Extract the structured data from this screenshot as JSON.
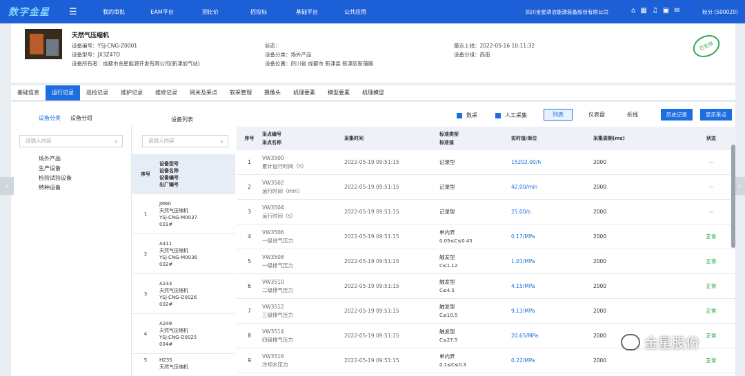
{
  "topbar": {
    "logo": "数字金星",
    "nav": [
      "我的审批",
      "EAM平台",
      "测比价",
      "招投标",
      "基础平台",
      "公共应用"
    ],
    "company": "四川金星清洁能源装备股份有限公司",
    "user": "秋分 (S00020)"
  },
  "header": {
    "title": "天然气压缩机",
    "code": "设备编号：YSJ-CNG-Z0001",
    "model": "设备型号：JX3Z47D",
    "owner": "设备所有者：成都市金星能源开发有限公司(新津加气站)",
    "status": "状态：",
    "category": "设备分类：场外产品",
    "location": "设备位置：四川省 成都市 新津县 新津区新蒲路",
    "last_online": "最近上线：2022-05-16 10:11:32",
    "group": "设备分组：西南",
    "stamp": "已生效"
  },
  "tabs": [
    "基础信息",
    "运行记录",
    "巡检记录",
    "维护记录",
    "维修记录",
    "网关及采点",
    "软采管理",
    "摄像头",
    "机理要素",
    "模型要素",
    "机理模型"
  ],
  "panel": {
    "cat_tabs": [
      "设备分类",
      "设备分组"
    ],
    "list_title": "设备列表",
    "search_placeholder": "请输入内容",
    "categories": [
      "场外产品",
      "生产设备",
      "检验试验设备",
      "特种设备"
    ],
    "legend": [
      "数采",
      "人工采集"
    ],
    "view_buttons": [
      "列表",
      "仪表盘",
      "折线"
    ],
    "history_button": "历史记录",
    "show_button": "显示采点"
  },
  "eq_table": {
    "head_no": "序号",
    "head_cols": "设备型号\n设备名称\n设备编号\n出厂编号",
    "rows": [
      {
        "no": "1",
        "info": "JM60\n天然气压缩机\nYSJ-CNG-M0037\n001#"
      },
      {
        "no": "2",
        "info": "A411\n天然气压缩机\nYSJ-CNG-M0036\n002#"
      },
      {
        "no": "3",
        "info": "A233\n天然气压缩机\nYSJ-CNG-D0026\n002#"
      },
      {
        "no": "4",
        "info": "A249\n天然气压缩机\nYSJ-CNG-D0025\n004#"
      },
      {
        "no": "5",
        "info": "H235\n天然气压缩机"
      }
    ]
  },
  "data_table": {
    "headers": {
      "no": "序号",
      "point": "采点编号\n采点名称",
      "time": "采集时间",
      "type": "标准类型\n标准值",
      "value": "实时值/单位",
      "cycle": "采集周期(ms)",
      "status": "状态"
    },
    "rows": [
      {
        "no": "1",
        "code": "VW3500",
        "name": "累计运行时间（h）",
        "time": "2022-05-19 09:51:15",
        "type": "记录型",
        "std": "",
        "value": "15202.00/h",
        "cycle": "2000",
        "status": "--"
      },
      {
        "no": "2",
        "code": "VW3502",
        "name": "运行时间（min）",
        "time": "2022-05-19 09:51:15",
        "type": "记录型",
        "std": "",
        "value": "42.00/min",
        "cycle": "2000",
        "status": "--"
      },
      {
        "no": "3",
        "code": "VW3504",
        "name": "运行时间（s）",
        "time": "2022-05-19 09:51:15",
        "type": "记录型",
        "std": "",
        "value": "25.00/s",
        "cycle": "2000",
        "status": "--"
      },
      {
        "no": "4",
        "code": "VW3506",
        "name": "一级进气压力",
        "time": "2022-05-19 09:51:15",
        "type": "单内界",
        "std": "0.05≤C≤0.45",
        "value": "0.17/MPa",
        "cycle": "2000",
        "status": "正常"
      },
      {
        "no": "5",
        "code": "VW3508",
        "name": "一级排气压力",
        "time": "2022-05-19 09:51:15",
        "type": "触发型",
        "std": "C≤1.12",
        "value": "1.01/MPa",
        "cycle": "2000",
        "status": "正常"
      },
      {
        "no": "6",
        "code": "VW3510",
        "name": "二级排气压力",
        "time": "2022-05-19 09:51:15",
        "type": "触发型",
        "std": "C≤4.5",
        "value": "4.15/MPa",
        "cycle": "2000",
        "status": "正常"
      },
      {
        "no": "7",
        "code": "VW3512",
        "name": "三级排气压力",
        "time": "2022-05-19 09:51:15",
        "type": "触发型",
        "std": "C≤10.5",
        "value": "9.13/MPa",
        "cycle": "2000",
        "status": "正常"
      },
      {
        "no": "8",
        "code": "VW3514",
        "name": "四级排气压力",
        "time": "2022-05-19 09:51:15",
        "type": "触发型",
        "std": "C≤27.5",
        "value": "20.65/MPa",
        "cycle": "2000",
        "status": "正常"
      },
      {
        "no": "9",
        "code": "VW3516",
        "name": "冷却水压力",
        "time": "2022-05-19 09:51:15",
        "type": "单内界",
        "std": "0.1≤C≤0.3",
        "value": "0.22/MPa",
        "cycle": "2000",
        "status": "正常"
      }
    ]
  },
  "watermark": "金星股份"
}
